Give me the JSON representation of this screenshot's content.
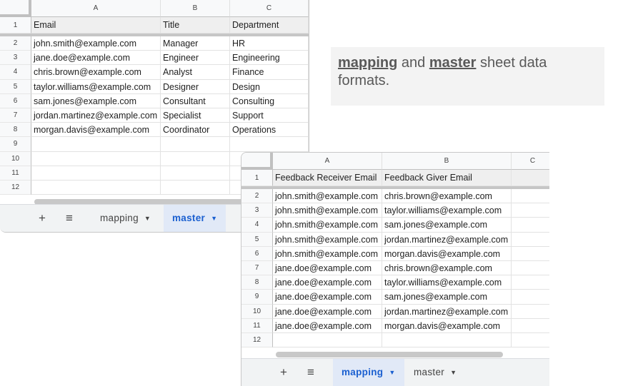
{
  "caption": {
    "word1": "mapping",
    "mid": " and ",
    "word2": "master",
    "rest": " sheet data formats."
  },
  "master_sheet": {
    "columns": [
      "A",
      "B",
      "C"
    ],
    "row_numbers": [
      "1",
      "2",
      "3",
      "4",
      "5",
      "6",
      "7",
      "8",
      "9",
      "10",
      "11",
      "12"
    ],
    "header": [
      "Email",
      "Title",
      "Department"
    ],
    "rows": [
      [
        "john.smith@example.com",
        "Manager",
        "HR"
      ],
      [
        "jane.doe@example.com",
        "Engineer",
        "Engineering"
      ],
      [
        "chris.brown@example.com",
        "Analyst",
        "Finance"
      ],
      [
        "taylor.williams@example.com",
        "Designer",
        "Design"
      ],
      [
        "sam.jones@example.com",
        "Consultant",
        "Consulting"
      ],
      [
        "jordan.martinez@example.com",
        "Specialist",
        "Support"
      ],
      [
        "morgan.davis@example.com",
        "Coordinator",
        "Operations"
      ],
      [
        "",
        "",
        ""
      ],
      [
        "",
        "",
        ""
      ],
      [
        "",
        "",
        ""
      ],
      [
        "",
        "",
        ""
      ]
    ],
    "tabs": [
      {
        "label": "mapping",
        "active": false
      },
      {
        "label": "master",
        "active": true
      }
    ]
  },
  "mapping_sheet": {
    "columns": [
      "A",
      "B",
      "C"
    ],
    "row_numbers": [
      "1",
      "2",
      "3",
      "4",
      "5",
      "6",
      "7",
      "8",
      "9",
      "10",
      "11",
      "12"
    ],
    "header": [
      "Feedback Receiver Email",
      "Feedback Giver Email"
    ],
    "rows": [
      [
        "john.smith@example.com",
        "chris.brown@example.com"
      ],
      [
        "john.smith@example.com",
        "taylor.williams@example.com"
      ],
      [
        "john.smith@example.com",
        "sam.jones@example.com"
      ],
      [
        "john.smith@example.com",
        "jordan.martinez@example.com"
      ],
      [
        "john.smith@example.com",
        "morgan.davis@example.com"
      ],
      [
        "jane.doe@example.com",
        "chris.brown@example.com"
      ],
      [
        "jane.doe@example.com",
        "taylor.williams@example.com"
      ],
      [
        "jane.doe@example.com",
        "sam.jones@example.com"
      ],
      [
        "jane.doe@example.com",
        "jordan.martinez@example.com"
      ],
      [
        "jane.doe@example.com",
        "morgan.davis@example.com"
      ],
      [
        "",
        ""
      ]
    ],
    "tabs": [
      {
        "label": "mapping",
        "active": true
      },
      {
        "label": "master",
        "active": false
      }
    ]
  },
  "tabbar": {
    "add_label": "+",
    "menu_label": "≡",
    "caret": "▼"
  }
}
